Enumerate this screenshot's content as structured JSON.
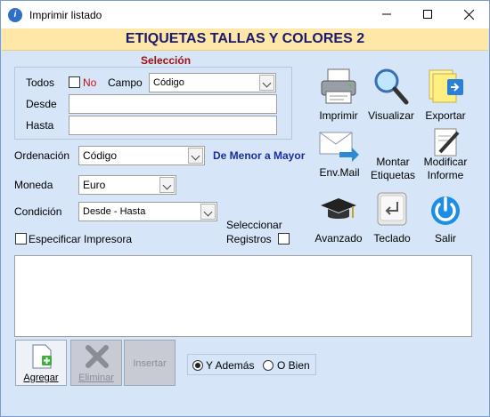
{
  "window": {
    "title": "Imprimir listado",
    "app_icon": "info-logo-icon",
    "minimize_icon": "minimize-icon",
    "maximize_icon": "maximize-icon",
    "close_icon": "close-icon"
  },
  "banner": {
    "title": "ETIQUETAS TALLAS Y COLORES 2",
    "bg_color": "#ffe7a8",
    "text_color": "#1a1a6e"
  },
  "seleccion": {
    "heading": "Selección",
    "todos_label": "Todos",
    "no_label": "No",
    "campo_label": "Campo",
    "campo_value": "Código",
    "desde_label": "Desde",
    "desde_value": "",
    "hasta_label": "Hasta",
    "hasta_value": ""
  },
  "ordenacion": {
    "label": "Ordenación",
    "value": "Código",
    "direction": "De Menor a Mayor"
  },
  "moneda": {
    "label": "Moneda",
    "value": "Euro"
  },
  "condicion": {
    "label": "Condición",
    "value": "Desde - Hasta"
  },
  "especificar_impresora": "Especificar Impresora",
  "seleccionar_registros": {
    "line1": "Seleccionar",
    "line2": "Registros"
  },
  "tools": {
    "imprimir": "Imprimir",
    "visualizar": "Visualizar",
    "exportar": "Exportar",
    "envmail": "Env.Mail",
    "montar_1": "Montar",
    "montar_2": "Etiquetas",
    "modificar_1": "Modificar",
    "modificar_2": "Informe",
    "avanzado": "Avanzado",
    "teclado": "Teclado",
    "salir": "Salir"
  },
  "notes": "",
  "bottom": {
    "agregar": "Agregar",
    "eliminar": "Eliminar",
    "insertar": "Insertar",
    "y_ademas": "Y Además",
    "o_bien": "O Bien"
  }
}
